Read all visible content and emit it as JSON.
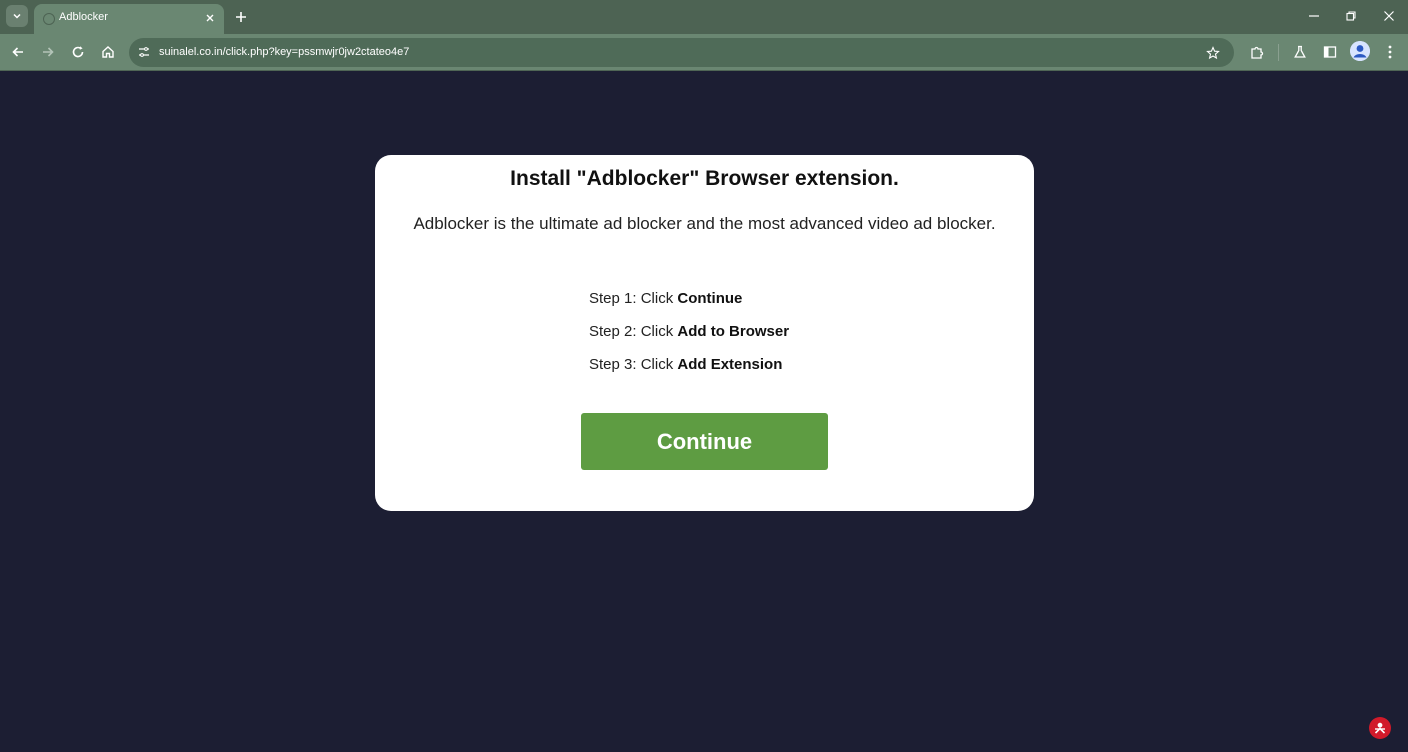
{
  "browser": {
    "tab_title": "Adblocker",
    "url": "suinalel.co.in/click.php?key=pssmwjr0jw2ctateo4e7"
  },
  "page": {
    "title": "Install \"Adblocker\" Browser extension.",
    "description": "Adblocker is the ultimate ad blocker and the most advanced video ad blocker.",
    "steps": [
      {
        "prefix": "Step 1: Click ",
        "action": "Continue"
      },
      {
        "prefix": "Step 2: Click ",
        "action": "Add to Browser"
      },
      {
        "prefix": "Step 3: Click ",
        "action": "Add Extension"
      }
    ],
    "button_label": "Continue"
  },
  "colors": {
    "page_background": "#1c1e33",
    "chrome_frame": "#4d6353",
    "toolbar": "#6a8772",
    "button": "#5e9c42"
  },
  "icons": {
    "tabbar": [
      "tab-search-icon",
      "tab-close-icon",
      "new-tab-icon",
      "minimize-icon",
      "restore-icon",
      "window-close-icon"
    ],
    "toolbar": [
      "back-icon",
      "forward-icon",
      "reload-icon",
      "home-icon",
      "site-info-icon",
      "bookmark-star-icon",
      "extensions-icon",
      "labs-icon",
      "side-panel-icon",
      "profile-avatar-icon",
      "menu-icon"
    ]
  }
}
